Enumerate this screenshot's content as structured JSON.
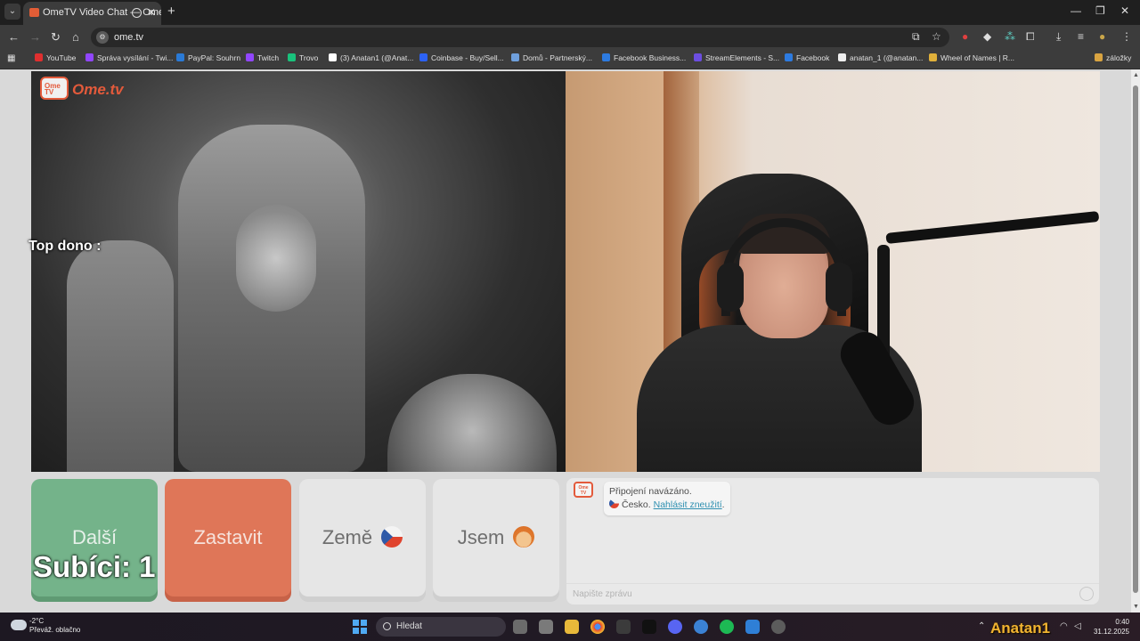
{
  "browser": {
    "tab_title": "OmeTV Video Chat — Ome",
    "url": "ome.tv",
    "bookmarks": [
      {
        "label": "YouTube",
        "color": "#e02f2f"
      },
      {
        "label": "Správa vysílání - Twi...",
        "color": "#9146ff"
      },
      {
        "label": "PayPal: Souhrn",
        "color": "#2a7ad6"
      },
      {
        "label": "Twitch",
        "color": "#9146ff"
      },
      {
        "label": "Trovo",
        "color": "#19c27c"
      },
      {
        "label": "(3) Anatan1 (@Anat...",
        "color": "#ffffff"
      },
      {
        "label": "Coinbase - Buy/Sell...",
        "color": "#2c62f5"
      },
      {
        "label": "Domů - Partnerský...",
        "color": "#6fa0dd"
      },
      {
        "label": "Facebook Business...",
        "color": "#2d7be0"
      },
      {
        "label": "StreamElements - S...",
        "color": "#6c4ee0"
      },
      {
        "label": "Facebook",
        "color": "#2d7be0"
      },
      {
        "label": "anatan_1 (@anatan...",
        "color": "#eeeeee"
      },
      {
        "label": "Wheel of Names | R...",
        "color": "#e0b03a"
      },
      {
        "label": "záložky",
        "color": "#d9a441"
      }
    ]
  },
  "page": {
    "brand": "Ome.tv",
    "logo_badge": "Ome TV",
    "overlay_top_dono": "Top dono :",
    "overlay_subs": "Subíci: 1",
    "buttons": {
      "next": "Další",
      "stop": "Zastavit",
      "country": "Země",
      "gender": "Jsem"
    },
    "chat": {
      "status": "Připojení navázáno.",
      "country": "Česko.",
      "report_link": "Nahlásit zneužití",
      "report_suffix": ".",
      "input_placeholder": "Napište zprávu"
    },
    "accent_color": "#e35a3b"
  },
  "taskbar": {
    "temperature": "-2°C",
    "weather": "Převáž. oblačno",
    "search_label": "Hledat",
    "time": "0:40",
    "date": "31.12.2025",
    "overlay_name": "Anatan1"
  }
}
